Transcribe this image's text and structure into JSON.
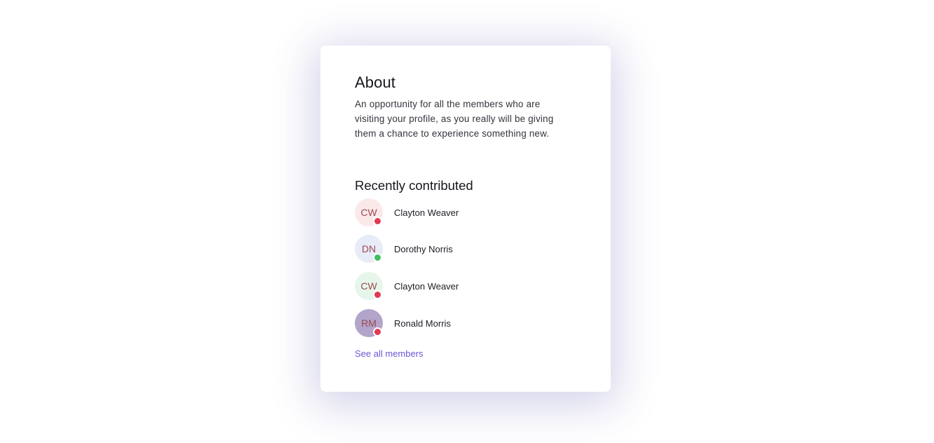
{
  "about": {
    "title": "About",
    "text": "An opportunity for all the members who are visiting your profile, as you really will be giving them a chance to experience something new."
  },
  "recent": {
    "title": "Recently contributed",
    "members": [
      {
        "initials": "CW",
        "name": "Clayton Weaver",
        "avatar_bg": "#fbe9ea",
        "status": "busy",
        "status_color": "#e03a52"
      },
      {
        "initials": "DN",
        "name": "Dorothy Norris",
        "avatar_bg": "#e8ebf8",
        "status": "online",
        "status_color": "#3fbf5f"
      },
      {
        "initials": "CW",
        "name": "Clayton Weaver",
        "avatar_bg": "#e6f6ea",
        "status": "busy",
        "status_color": "#e03a52"
      },
      {
        "initials": "RM",
        "name": "Ronald Morris",
        "avatar_bg": "#b3a4c9",
        "status": "busy",
        "status_color": "#e03a52"
      }
    ]
  },
  "footer": {
    "see_all_label": "See all members",
    "link_color": "#6a57d6"
  }
}
